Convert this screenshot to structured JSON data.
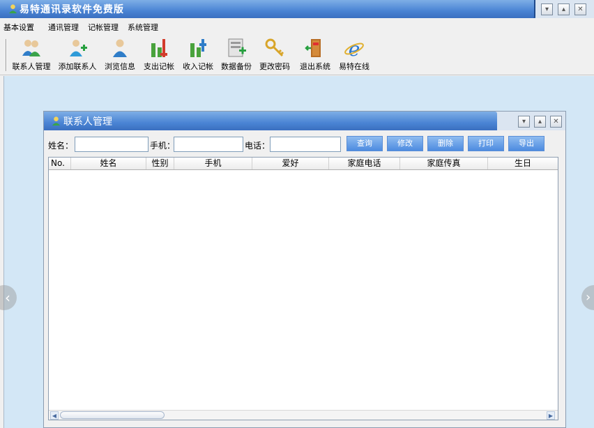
{
  "app": {
    "title": "易特通讯录软件免费版"
  },
  "window_controls": {
    "minimize": "▾",
    "restore": "▴",
    "close": "✕"
  },
  "menu": [
    "基本设置",
    "通讯管理",
    "记帐管理",
    "系统管理"
  ],
  "toolbar": [
    {
      "label": "联系人管理",
      "icon": "contacts-icon"
    },
    {
      "label": "添加联系人",
      "icon": "add-contact-icon"
    },
    {
      "label": "浏览信息",
      "icon": "browse-info-icon"
    },
    {
      "label": "支出记帐",
      "icon": "expense-chart-icon"
    },
    {
      "label": "收入记帐",
      "icon": "income-chart-icon"
    },
    {
      "label": "数据备份",
      "icon": "backup-icon"
    },
    {
      "label": "更改密码",
      "icon": "key-icon"
    },
    {
      "label": "退出系统",
      "icon": "exit-door-icon"
    },
    {
      "label": "易特在线",
      "icon": "ie-browser-icon"
    }
  ],
  "child_window": {
    "title": "联系人管理",
    "search": {
      "name_label": "姓名：",
      "name_value": "",
      "mobile_label": "手机：",
      "mobile_value": "",
      "phone_label": "电话：",
      "phone_value": ""
    },
    "buttons": {
      "query": "查询",
      "edit": "修改",
      "delete": "删除",
      "print": "打印",
      "export": "导出"
    },
    "columns": [
      "No.",
      "姓名",
      "性别",
      "手机",
      "爱好",
      "家庭电话",
      "家庭传真",
      "生日"
    ],
    "rows": []
  },
  "colors": {
    "title_blue": "#3b74c4",
    "workspace_bg": "#d3e7f6",
    "button_blue": "#4d8be0"
  }
}
